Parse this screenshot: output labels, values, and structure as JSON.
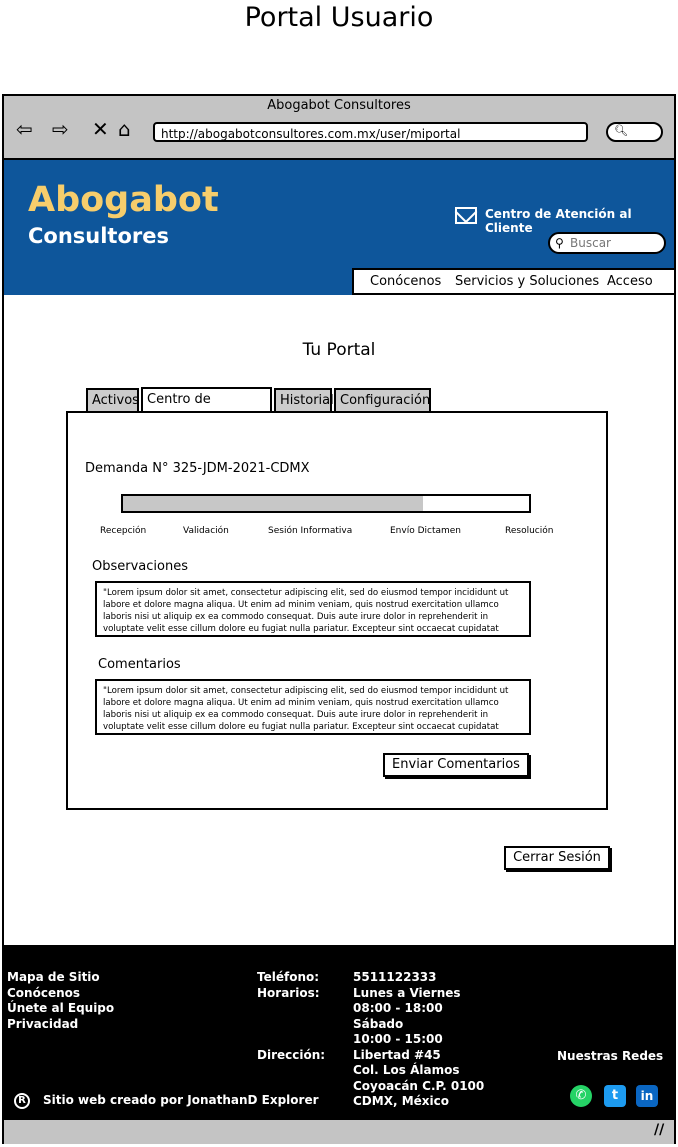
{
  "page_title": "Portal Usuario",
  "browser": {
    "window_title": "Abogabot Consultores",
    "url": "http://abogabotconsultores.com.mx/user/miportal"
  },
  "header": {
    "brand": "Abogabot",
    "brand_sub": "Consultores",
    "atencion": "Centro de Atención al Cliente",
    "search_placeholder": "Buscar",
    "menu": [
      "Conócenos",
      "Servicios y Soluciones",
      "Acceso"
    ]
  },
  "portal": {
    "title": "Tu Portal",
    "tabs": [
      "Activos",
      "Centro de Mensajes",
      "Historial",
      "Configuración"
    ],
    "active_tab": "Centro de Mensajes",
    "demanda": "Demanda N° 325-JDM-2021-CDMX",
    "progress_fraction": 0.74,
    "steps": [
      "Recepción",
      "Validación",
      "Sesión Informativa",
      "Envío Dictamen",
      "Resolución"
    ],
    "observaciones_label": "Observaciones",
    "observaciones_text": "\"Lorem ipsum dolor sit amet, consectetur adipiscing elit, sed do eiusmod tempor incididunt ut labore et dolore magna aliqua. Ut enim ad minim veniam, quis nostrud exercitation ullamco laboris nisi ut aliquip ex ea commodo consequat. Duis aute irure dolor in reprehenderit in voluptate velit esse cillum dolore eu fugiat nulla pariatur. Excepteur sint occaecat cupidatat",
    "comentarios_label": "Comentarios",
    "comentarios_text": "\"Lorem ipsum dolor sit amet, consectetur adipiscing elit, sed do eiusmod tempor incididunt ut labore et dolore magna aliqua. Ut enim ad minim veniam, quis nostrud exercitation ullamco laboris nisi ut aliquip ex ea commodo consequat. Duis aute irure dolor in reprehenderit in voluptate velit esse cillum dolore eu fugiat nulla pariatur. Excepteur sint occaecat cupidatat",
    "enviar_button": "Enviar Comentarios",
    "logout_button": "Cerrar Sesión"
  },
  "footer": {
    "links": [
      "Mapa de Sitio",
      "Conócenos",
      "Únete al Equipo",
      "Privacidad"
    ],
    "telefono_label": "Teléfono:",
    "telefono": "5511122333",
    "horarios_label": "Horarios:",
    "horarios": [
      "Lunes a Viernes",
      "08:00 - 18:00",
      "Sábado",
      "10:00 - 15:00"
    ],
    "direccion_label": "Dirección:",
    "direccion": [
      "Libertad #45",
      "Col. Los Álamos",
      "Coyoacán C.P. 0100",
      "CDMX, México"
    ],
    "redes_label": "Nuestras Redes",
    "credits": "Sitio web creado por JonathanD Explorer",
    "registered_symbol": "R"
  },
  "colors": {
    "header_bg": "#0e569b",
    "brand": "#f6cd6c",
    "whatsapp": "#25d366",
    "twitter": "#1d9bf0",
    "linkedin": "#0a66c2"
  }
}
